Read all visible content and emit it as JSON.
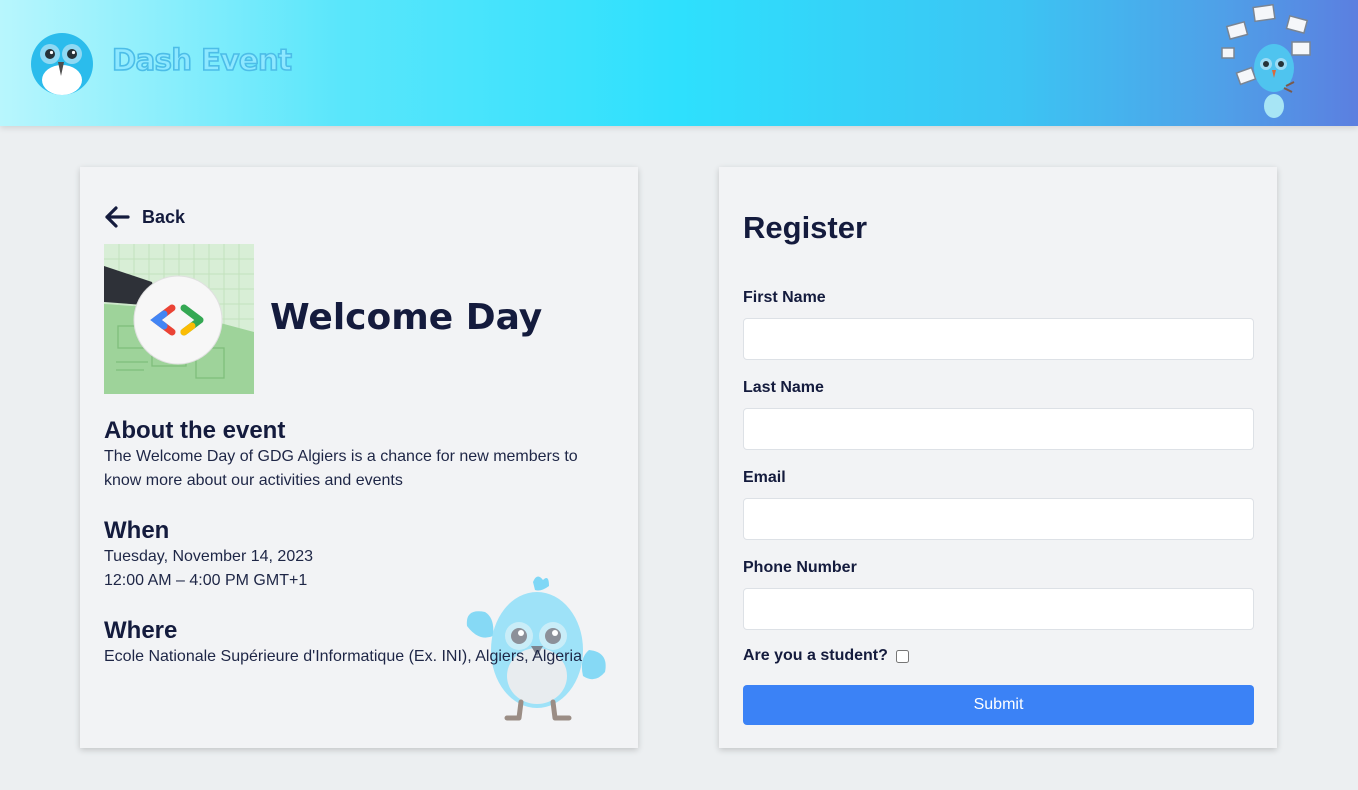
{
  "header": {
    "brand": "Dash Event",
    "logo_icon": "owl-logo-icon",
    "mascot_icon": "bird-mascot-juggling-laptops-icon",
    "gradient_start": "#b8f6fd",
    "gradient_end": "#5b7fe0"
  },
  "event": {
    "back_label": "Back",
    "title": "Welcome Day",
    "thumbnail_icon": "gdg-code-brackets-icon",
    "about_heading": "About the event",
    "about_text_line1": "The Welcome Day of GDG Algiers is a chance for new members to",
    "about_text_line2": "know more about our activities and events",
    "when_heading": "When",
    "when_date": "Tuesday, November 14, 2023",
    "when_time": "12:00 AM – 4:00 PM GMT+1",
    "where_heading": "Where",
    "where_text": "Ecole Nationale Supérieure d'Informatique (Ex. INI), Algiers, Algeria",
    "mascot_icon": "bird-mascot-icon"
  },
  "register": {
    "title": "Register",
    "first_name_label": "First Name",
    "first_name_value": "",
    "last_name_label": "Last Name",
    "last_name_value": "",
    "email_label": "Email",
    "email_value": "",
    "phone_label": "Phone Number",
    "phone_value": "",
    "student_label": "Are you a student?",
    "student_checked": false,
    "submit_label": "Submit",
    "submit_color": "#3b82f6"
  }
}
